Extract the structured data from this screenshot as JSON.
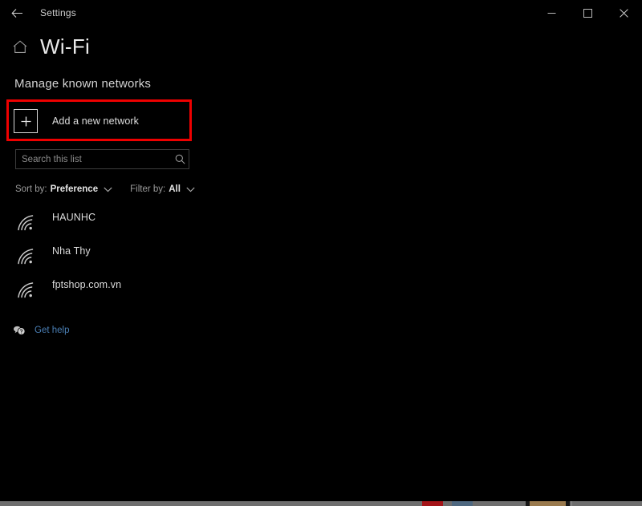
{
  "window": {
    "app_title": "Settings",
    "back_icon": "back-arrow-icon",
    "controls": {
      "minimize": "minimize-icon",
      "maximize": "maximize-icon",
      "close": "close-icon"
    }
  },
  "header": {
    "home_icon": "home-icon",
    "title": "Wi-Fi"
  },
  "main": {
    "section_heading": "Manage known networks",
    "add_network": {
      "label": "Add a new network",
      "icon": "plus-icon",
      "highlighted": true,
      "highlight_color": "#ee0000"
    },
    "search": {
      "placeholder": "Search this list",
      "value": "",
      "icon": "search-icon"
    },
    "sort": {
      "label": "Sort by:",
      "value": "Preference",
      "chevron": "chevron-down-icon"
    },
    "filter": {
      "label": "Filter by:",
      "value": "All",
      "chevron": "chevron-down-icon"
    },
    "networks": [
      {
        "name": "HAUNHC",
        "icon": "wifi-icon"
      },
      {
        "name": "Nha Thy",
        "icon": "wifi-icon"
      },
      {
        "name": "fptshop.com.vn",
        "icon": "wifi-icon"
      }
    ],
    "get_help": {
      "label": "Get help",
      "icon": "help-bubble-icon",
      "color": "#4a7fb5"
    }
  },
  "theme": {
    "background": "#000000",
    "text": "#e6e6e6",
    "muted_text": "#9b9b9b",
    "link": "#4a7fb5",
    "border": "#3c3c3c",
    "taskbar": "#6e6e6e"
  }
}
